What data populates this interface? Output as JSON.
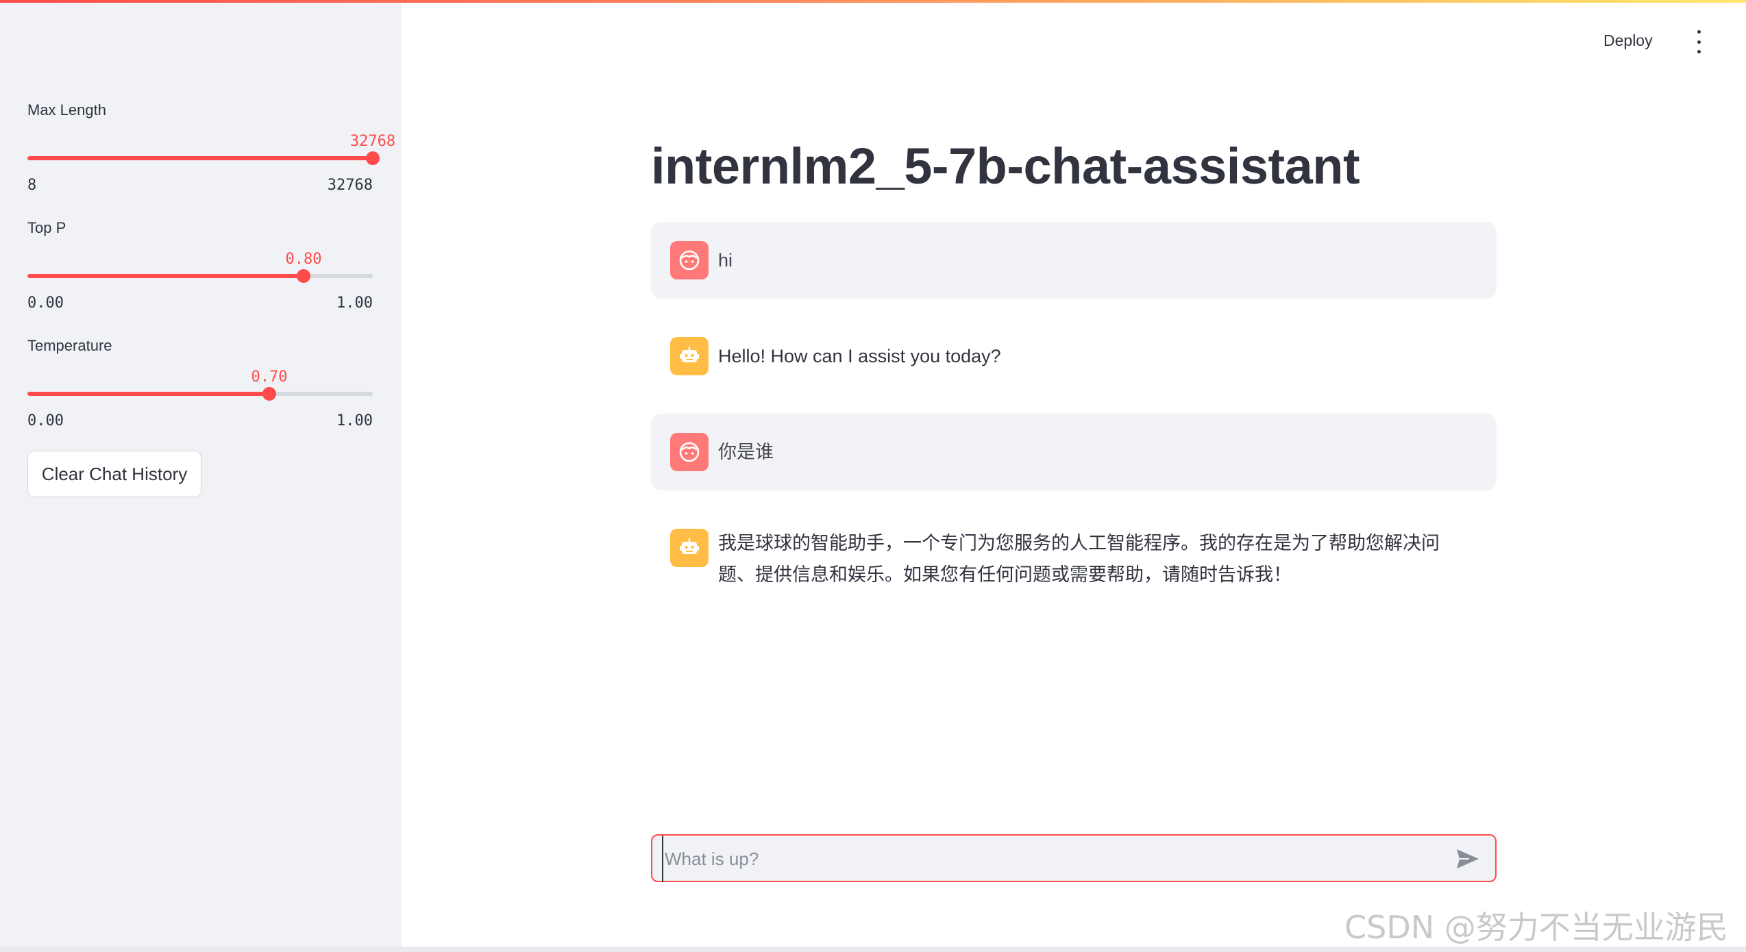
{
  "header": {
    "deploy_label": "Deploy",
    "menu_icon": "kebab-menu-icon"
  },
  "sidebar": {
    "sliders": [
      {
        "label": "Max Length",
        "value": "32768",
        "min": "8",
        "max": "32768",
        "fraction": 1.0
      },
      {
        "label": "Top P",
        "value": "0.80",
        "min": "0.00",
        "max": "1.00",
        "fraction": 0.8
      },
      {
        "label": "Temperature",
        "value": "0.70",
        "min": "0.00",
        "max": "1.00",
        "fraction": 0.7
      }
    ],
    "clear_button": "Clear Chat History"
  },
  "main": {
    "title": "internlm2_5-7b-chat-assistant",
    "messages": [
      {
        "role": "user",
        "avatar_icon": "user-face-icon",
        "text": "hi"
      },
      {
        "role": "assistant",
        "avatar_icon": "robot-icon",
        "text": "Hello! How can I assist you today?"
      },
      {
        "role": "user",
        "avatar_icon": "user-face-icon",
        "text": "你是谁"
      },
      {
        "role": "assistant",
        "avatar_icon": "robot-icon",
        "text": "我是球球的智能助手，一个专门为您服务的人工智能程序。我的存在是为了帮助您解决问题、提供信息和娱乐。如果您有任何问题或需要帮助，请随时告诉我！"
      }
    ],
    "input": {
      "placeholder": "What is up?",
      "value": ""
    }
  },
  "watermark": "CSDN @努力不当无业游民",
  "colors": {
    "accent": "#ff4b4b",
    "sidebar_bg": "#f0f2f6",
    "user_avatar": "#ff6b6b",
    "bot_avatar": "#ffbd45"
  }
}
